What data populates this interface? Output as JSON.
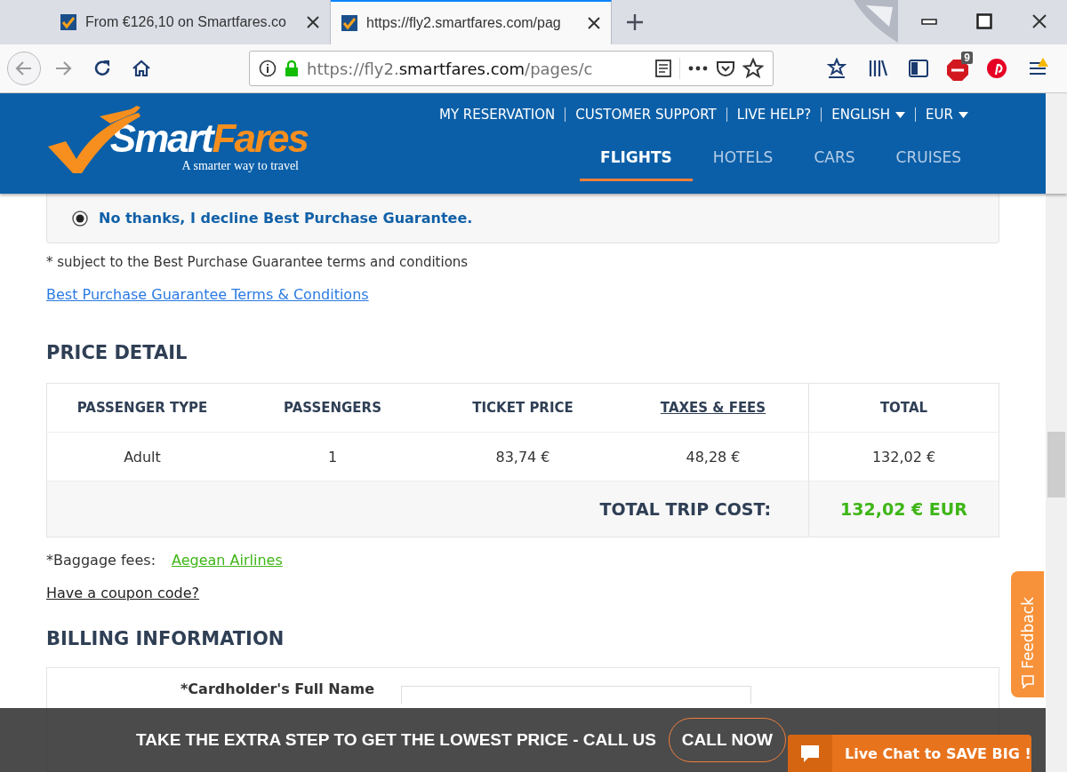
{
  "browser": {
    "tabs": [
      {
        "title": "From €126,10 on Smartfares.co",
        "selected": false
      },
      {
        "title": "https://fly2.smartfares.com/pag",
        "selected": true
      }
    ],
    "url": {
      "prefix": "https://fly2.",
      "domain": "smartfares.com",
      "path": "/pages/c"
    },
    "adblock_count": "9"
  },
  "header": {
    "logo": {
      "name_1": "Smart",
      "name_2": "Fares",
      "tagline": "A smarter way to travel"
    },
    "top_links": [
      {
        "label": "MY RESERVATION",
        "dropdown": false
      },
      {
        "label": "CUSTOMER SUPPORT",
        "dropdown": false
      },
      {
        "label": "LIVE HELP?",
        "dropdown": false
      },
      {
        "label": "ENGLISH",
        "dropdown": true
      },
      {
        "label": "EUR",
        "dropdown": true
      }
    ],
    "nav": [
      {
        "label": "FLIGHTS",
        "selected": true
      },
      {
        "label": "HOTELS",
        "selected": false
      },
      {
        "label": "CARS",
        "selected": false
      },
      {
        "label": "CRUISES",
        "selected": false
      }
    ]
  },
  "guarantee": {
    "option": {
      "label": "No thanks, I decline Best Purchase Guarantee.",
      "selected": true
    },
    "note": "* subject to the Best Purchase Guarantee terms and conditions",
    "terms_link": "Best Purchase Guarantee Terms & Conditions"
  },
  "price_detail": {
    "heading": "PRICE DETAIL",
    "columns": [
      {
        "label": "PASSENGER TYPE",
        "underlined": false
      },
      {
        "label": "PASSENGERS",
        "underlined": false
      },
      {
        "label": "TICKET PRICE",
        "underlined": false
      },
      {
        "label": "TAXES & FEES",
        "underlined": true
      },
      {
        "label": "TOTAL",
        "underlined": false
      }
    ],
    "rows": [
      [
        "Adult",
        "1",
        "83,74 €",
        "48,28 €",
        "132,02 €"
      ]
    ],
    "total_label": "TOTAL TRIP COST:",
    "total_value": "132,02 € EUR"
  },
  "baggage": {
    "label": "*Baggage fees:",
    "link": "Aegean Airlines"
  },
  "coupon_link": "Have a coupon code?",
  "billing": {
    "heading": "BILLING INFORMATION",
    "field_label": "*Cardholder's Full Name"
  },
  "promo_bar": {
    "text": "TAKE THE EXTRA STEP TO GET THE LOWEST PRICE - CALL US",
    "button": "CALL NOW"
  },
  "live_chat": "Live Chat to SAVE BIG !",
  "feedback": "Feedback"
}
